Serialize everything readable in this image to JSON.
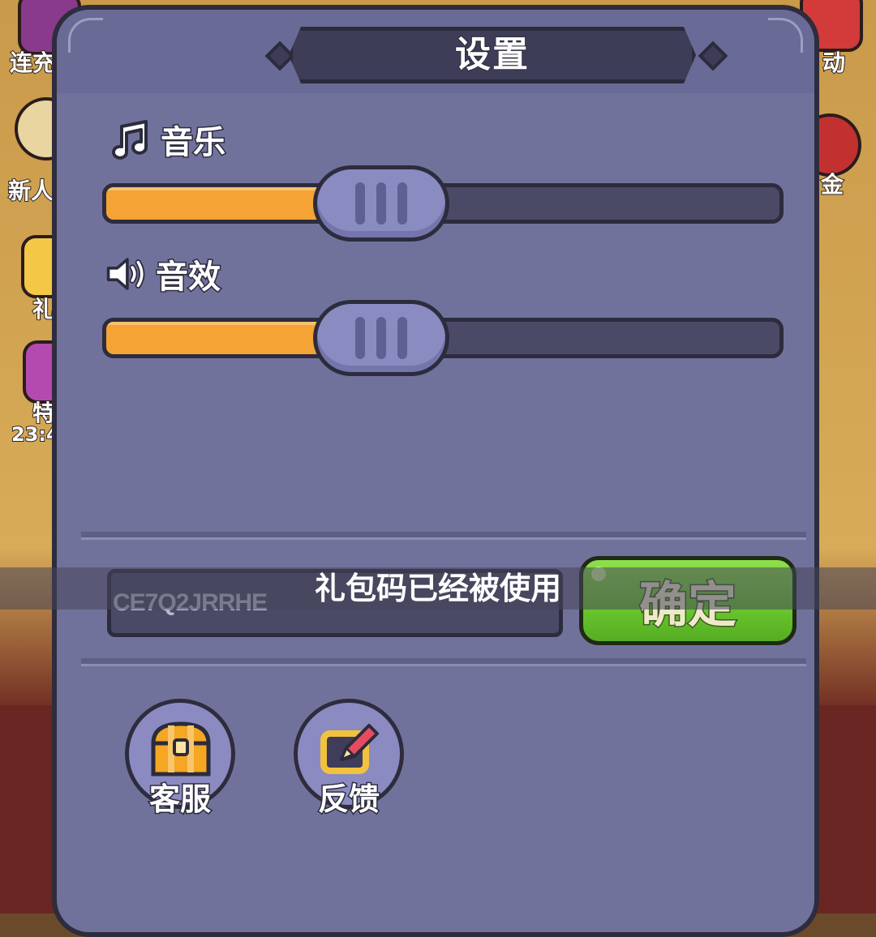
{
  "background": {
    "left_labels": [
      "连充",
      "新人",
      "礼",
      "特"
    ],
    "right_labels": [
      "动",
      "金"
    ],
    "timer": "23:4"
  },
  "dialog": {
    "title": "设置",
    "music": {
      "label": "音乐",
      "icon": "music-note-icon",
      "level": 0.41
    },
    "sound": {
      "label": "音效",
      "icon": "speaker-icon",
      "level": 0.41
    },
    "gift_code": {
      "value": "CE7Q2JRRHE",
      "placeholder": ""
    },
    "confirm_label": "确定",
    "toast": "礼包码已经被使用",
    "buttons": [
      {
        "label": "客服",
        "icon": "treasure-chest-icon"
      },
      {
        "label": "反馈",
        "icon": "pencil-edit-icon"
      }
    ]
  },
  "colors": {
    "panel": "#71729c",
    "slider_fill": "#f4a334",
    "confirm_green": "#6cc830"
  }
}
